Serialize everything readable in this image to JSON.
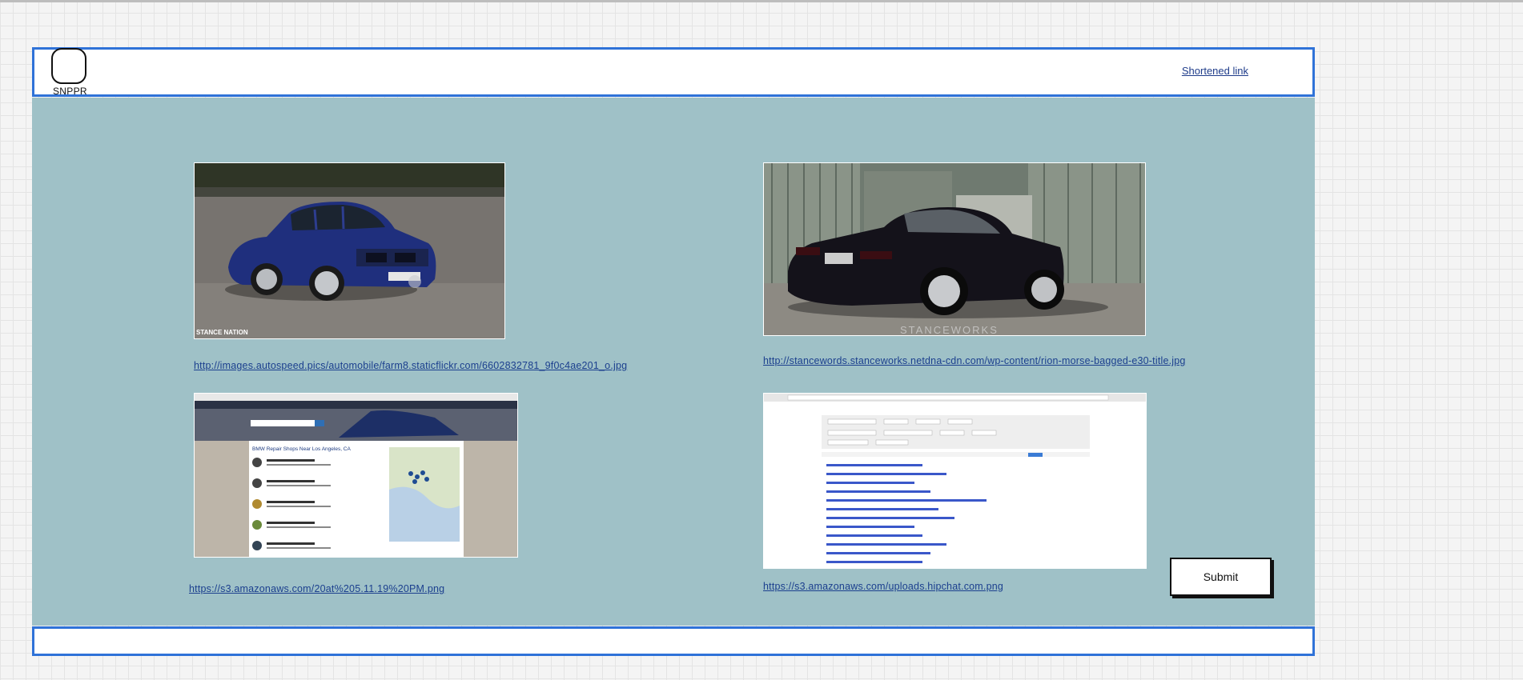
{
  "header": {
    "logo_text": "SNPPR",
    "shortened_link_label": "Shortened link"
  },
  "gallery": {
    "item1": {
      "url": "http://images.autospeed.pics/automobile/farm8.staticflickr.com/6602832781_9f0c4ae201_o.jpg",
      "watermark": "STANCE NATION"
    },
    "item2": {
      "url": "http://stancewords.stanceworks.netdna-cdn.com/wp-content/rion-morse-bagged-e30-title.jpg",
      "watermark": "STANCEWORKS"
    },
    "item3": {
      "url": "https://s3.amazonaws.com/20at%205.11.19%20PM.png",
      "page_heading": "BMW Repair Shops Near Los Angeles, CA"
    },
    "item4": {
      "url": "https://s3.amazonaws.com/uploads.hipchat.com.png"
    }
  },
  "form": {
    "submit_label": "Submit"
  },
  "colors": {
    "accent_border": "#2f72d8",
    "main_background": "#9fc1c7",
    "link": "#1b3f8e"
  }
}
